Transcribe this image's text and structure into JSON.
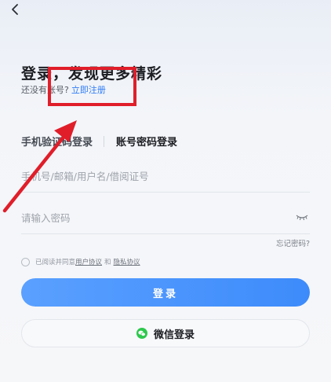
{
  "header": {
    "back_icon": "chevron-left-icon"
  },
  "title": "登录，发现更多精彩",
  "subtitle": {
    "prefix": "还没有账号?",
    "register_link": "立即注册"
  },
  "tabs": [
    {
      "label": "手机验证码登录",
      "active": false
    },
    {
      "label": "账号密码登录",
      "active": true
    }
  ],
  "account_input": {
    "value": "",
    "placeholder": "手机号/邮箱/用户名/借阅证号"
  },
  "password_input": {
    "value": "",
    "placeholder": "请输入密码",
    "visibility_icon": "eye-closed-icon"
  },
  "forgot_password": "忘记密码?",
  "agreement": {
    "text": "已阅读并同意",
    "user_agreement": "用户协议",
    "conjunction": "和",
    "privacy_policy": "隐私协议",
    "checked": false
  },
  "login_button": "登录",
  "wechat_login": {
    "label": "微信登录",
    "icon": "wechat-icon",
    "icon_color": "#2dc84d"
  },
  "annotation": {
    "box_color": "#e01e2a",
    "arrow_color": "#e01e2a"
  },
  "colors": {
    "accent": "#3d8bfb",
    "link": "#2f7cf6"
  }
}
